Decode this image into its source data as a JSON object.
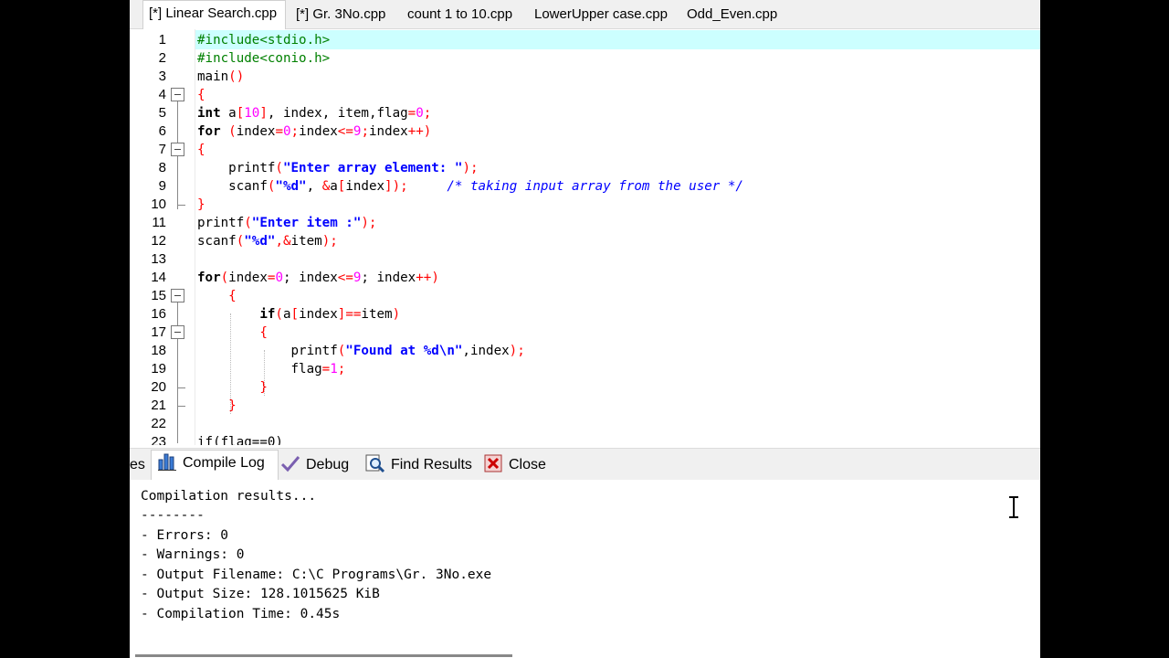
{
  "tabs": [
    {
      "label": "[*] Linear Search.cpp"
    },
    {
      "label": "[*] Gr. 3No.cpp"
    },
    {
      "label": "count 1 to 10.cpp"
    },
    {
      "label": "LowerUpper case.cpp"
    },
    {
      "label": "Odd_Even.cpp"
    }
  ],
  "code": {
    "line_numbers": [
      "1",
      "2",
      "3",
      "4",
      "5",
      "6",
      "7",
      "8",
      "9",
      "10",
      "11",
      "12",
      "13",
      "14",
      "15",
      "16",
      "17",
      "18",
      "19",
      "20",
      "21",
      "22",
      "23"
    ],
    "lines": {
      "l1": "#include<stdio.h>",
      "l2": "#include<conio.h>",
      "l3_a": "main",
      "l3_b": "()",
      "l4": "{",
      "l5": [
        "int",
        " a",
        "[",
        "10",
        "]",
        ", index, item,flag",
        "=",
        "0",
        ";"
      ],
      "l6": [
        "for",
        " ",
        "(",
        "index",
        "=",
        "0",
        ";",
        "index",
        "<=",
        "9",
        ";",
        "index",
        "++",
        ")"
      ],
      "l7": "{",
      "l8": [
        "    printf",
        "(",
        "\"Enter array element: \"",
        ");"
      ],
      "l9": [
        "    scanf",
        "(",
        "\"%d\"",
        ", ",
        "&",
        "a",
        "[",
        "index",
        "]);",
        "     ",
        "/* taking input array from the user */"
      ],
      "l10": "}",
      "l11": [
        "printf",
        "(",
        "\"Enter item :\"",
        ");"
      ],
      "l12": [
        "scanf",
        "(",
        "\"%d\"",
        ",",
        "&",
        "item",
        ");"
      ],
      "l13": "",
      "l14": [
        "for",
        "(",
        "index",
        "=",
        "0",
        "; index",
        "<=",
        "9",
        "; index",
        "++",
        ")"
      ],
      "l15": "    {",
      "l16": [
        "        if",
        "(",
        "a",
        "[",
        "index",
        "]==",
        "item",
        ")"
      ],
      "l17": "        {",
      "l18": [
        "            printf",
        "(",
        "\"Found at %d\\n\"",
        ",index",
        ");"
      ],
      "l19": [
        "            flag",
        "=",
        "1",
        ";"
      ],
      "l20": "        }",
      "l21": "    }",
      "l22": "",
      "l23": "if(flag==0)"
    }
  },
  "bottom_tabs": [
    {
      "label": "es"
    },
    {
      "label": "Compile Log",
      "icon": "bar-chart-icon"
    },
    {
      "label": "Debug",
      "icon": "checkmark-icon"
    },
    {
      "label": "Find Results",
      "icon": "find-icon"
    },
    {
      "label": "Close",
      "icon": "close-icon"
    }
  ],
  "compile_log": {
    "lines": [
      "Compilation results...",
      "--------",
      "- Errors: 0",
      "- Warnings: 0",
      "- Output Filename: C:\\C Programs\\Gr. 3No.exe",
      "- Output Size: 128.1015625 KiB",
      "- Compilation Time: 0.45s"
    ]
  },
  "colors": {
    "current_line": "#ccffff",
    "preprocessor": "#008000",
    "string": "#0000ff",
    "number": "#ff00ff",
    "operator": "#ff0000",
    "comment": "#0000ff"
  }
}
